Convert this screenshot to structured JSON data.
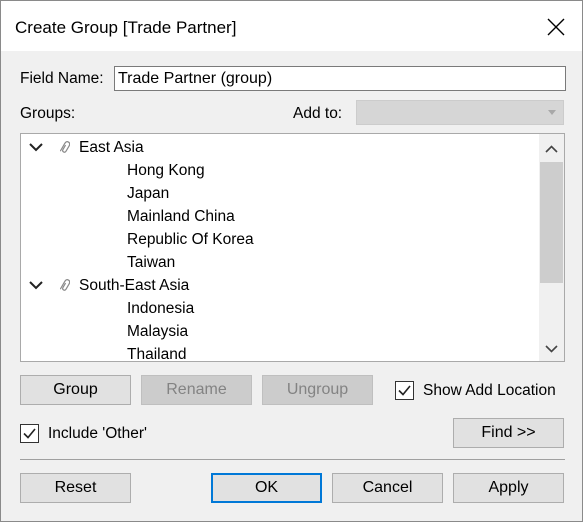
{
  "dialog": {
    "title": "Create Group [Trade Partner]",
    "field_name_label": "Field Name:",
    "field_name_value": "Trade Partner (group)",
    "groups_label": "Groups:",
    "add_to_label": "Add to:",
    "add_to_value": ""
  },
  "tree": {
    "groups": [
      {
        "name": "East Asia",
        "members": [
          "Hong Kong",
          "Japan",
          "Mainland China",
          "Republic Of Korea",
          "Taiwan"
        ]
      },
      {
        "name": "South-East Asia",
        "members": [
          "Indonesia",
          "Malaysia",
          "Thailand"
        ]
      }
    ]
  },
  "buttons": {
    "group": "Group",
    "rename": "Rename",
    "ungroup": "Ungroup",
    "find": "Find >>",
    "reset": "Reset",
    "ok": "OK",
    "cancel": "Cancel",
    "apply": "Apply"
  },
  "options": {
    "show_add_location": {
      "label": "Show Add Location",
      "checked": true
    },
    "include_other": {
      "label": "Include 'Other'",
      "checked": true
    }
  },
  "icons": {
    "close": "close-icon",
    "expand": "chevron-down-icon",
    "group": "paperclip-icon",
    "dropdown": "dropdown-arrow-icon",
    "scroll_up": "scroll-up-icon",
    "scroll_down": "scroll-down-icon",
    "check": "checkmark-icon"
  },
  "colors": {
    "accent": "#0078d7",
    "dialog_bg": "#f0f0f0",
    "disabled_button": "#cccccc"
  }
}
